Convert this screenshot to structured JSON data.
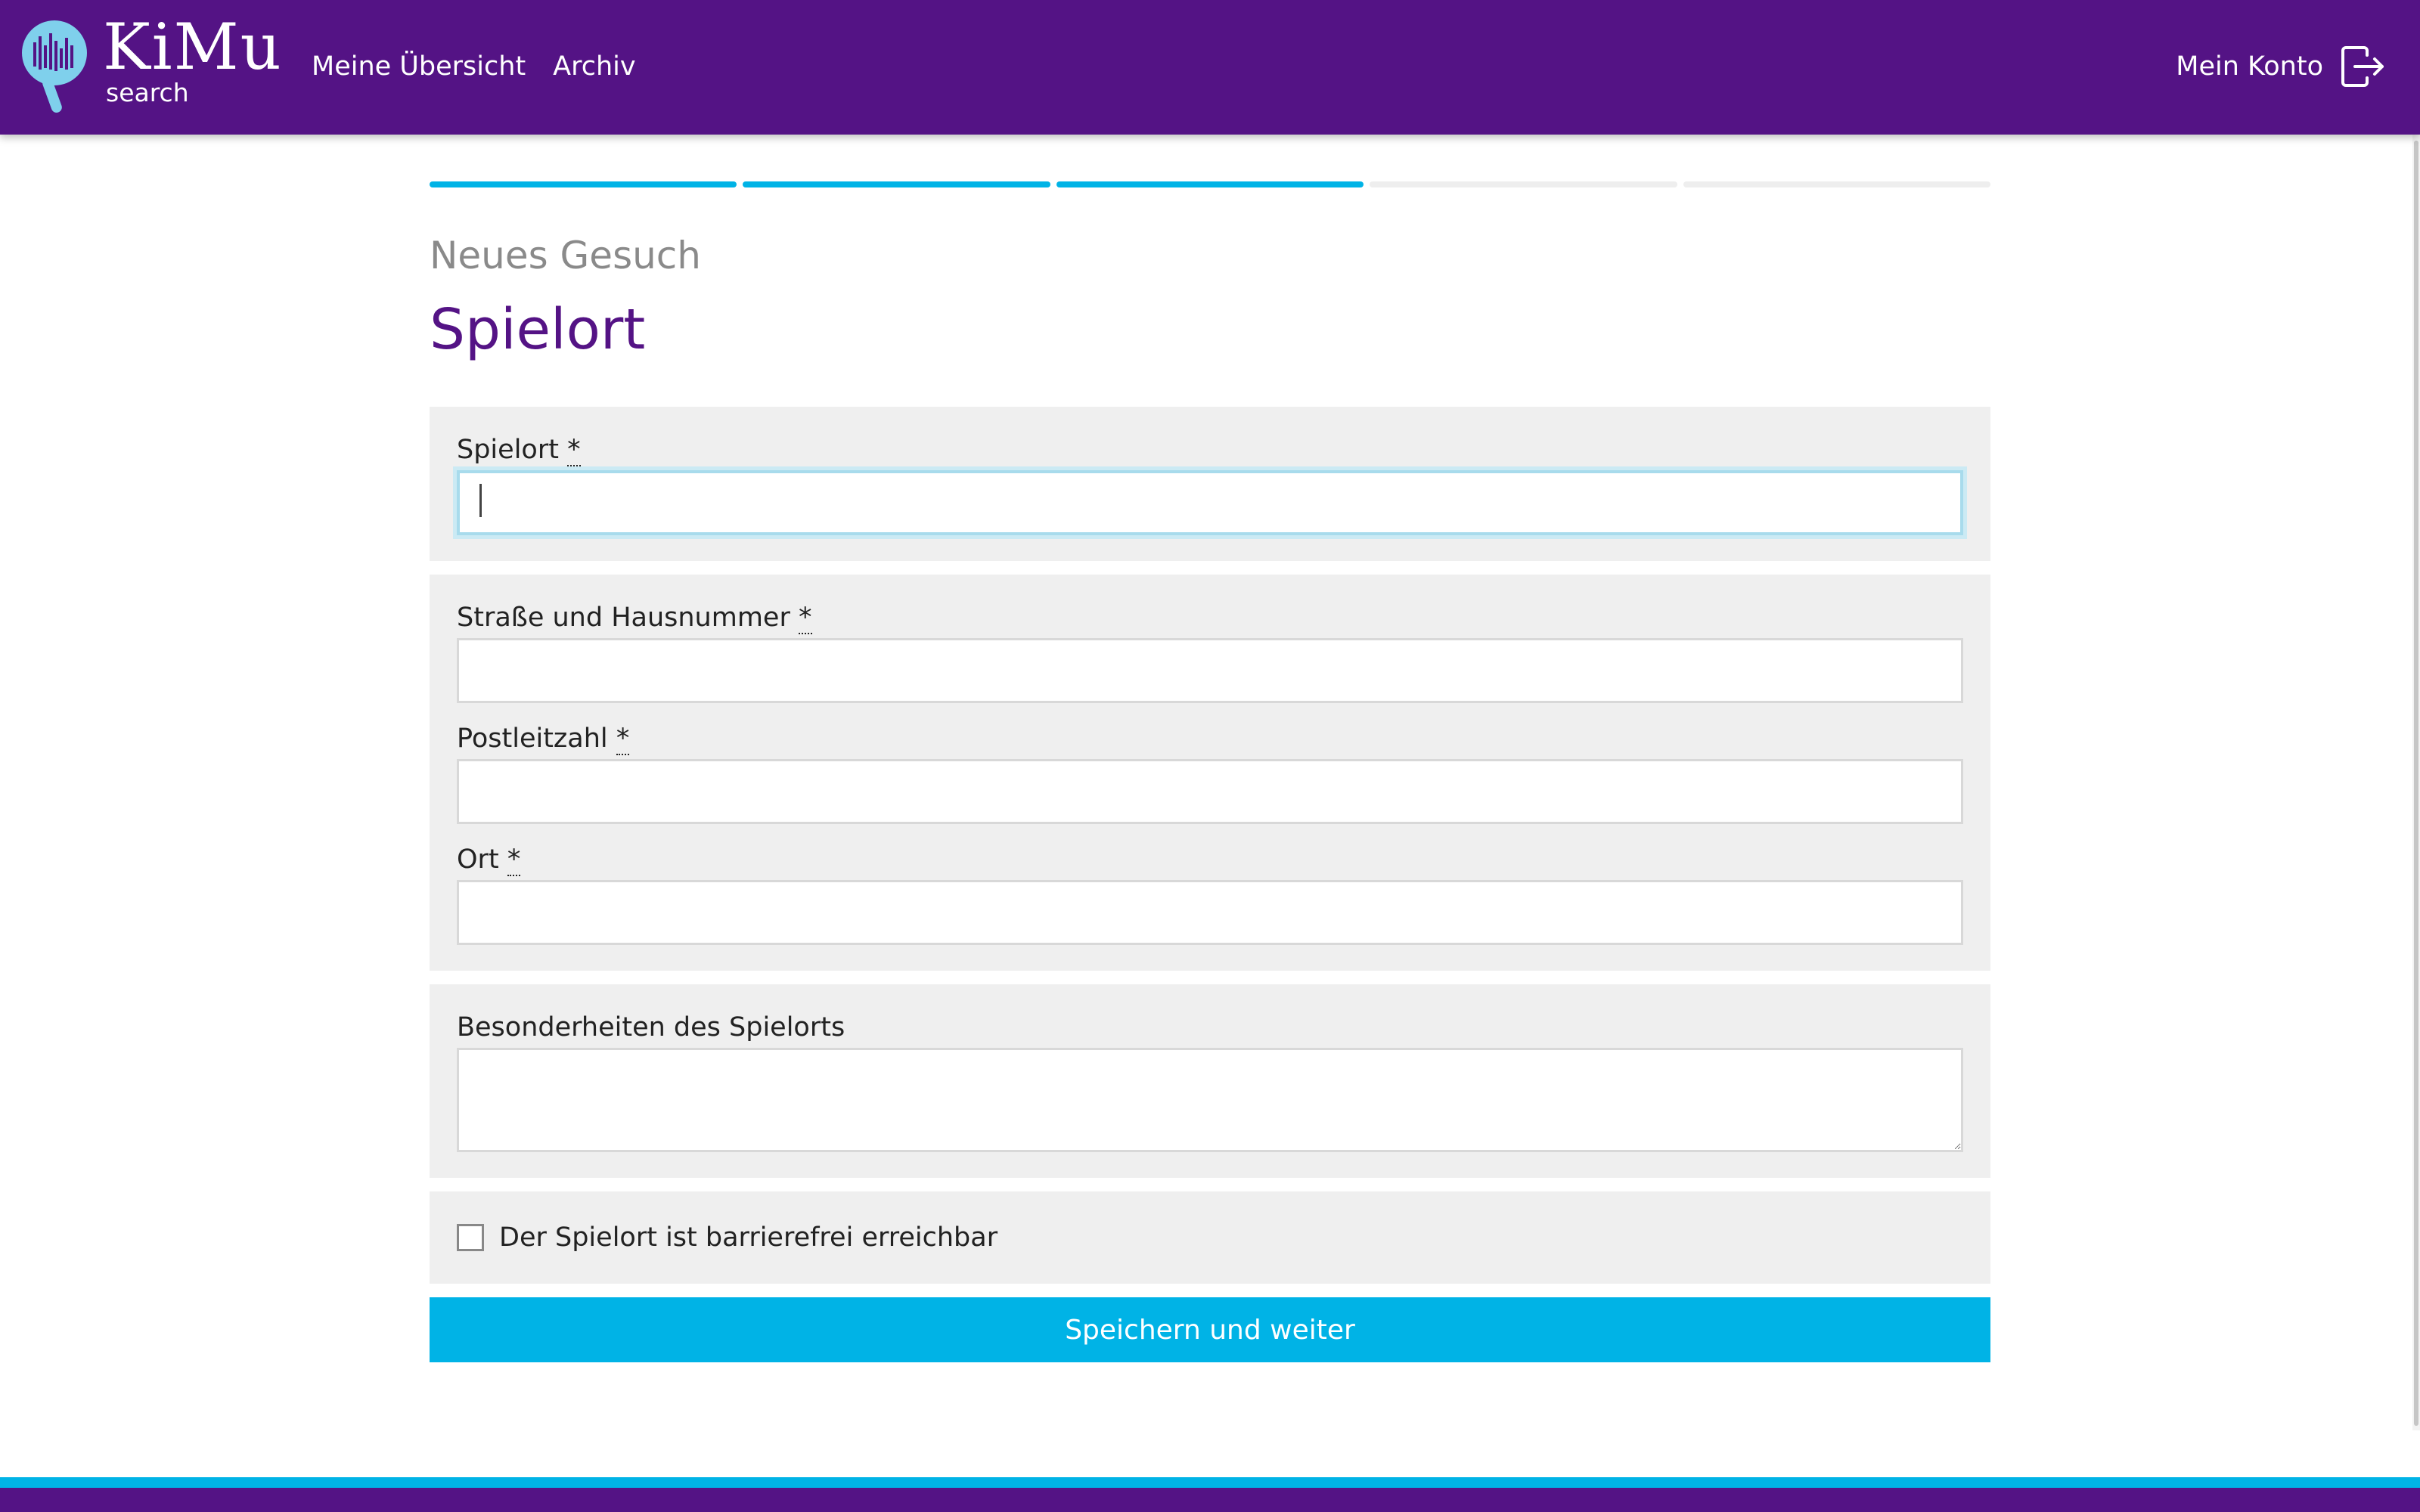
{
  "header": {
    "logo": {
      "name": "KiMu",
      "sub": "search",
      "icon": "magnifier-soundwave-icon"
    },
    "nav": [
      {
        "label": "Meine Übersicht"
      },
      {
        "label": "Archiv"
      }
    ],
    "account": {
      "label": "Mein Konto",
      "icon": "logout-icon"
    }
  },
  "progress": {
    "steps_total": 5,
    "steps_completed": 3
  },
  "main": {
    "kicker": "Neues Gesuch",
    "title": "Spielort"
  },
  "form": {
    "required_mark": "*",
    "spielort": {
      "label": "Spielort",
      "value": ""
    },
    "strasse": {
      "label": "Straße und Hausnummer",
      "value": ""
    },
    "plz": {
      "label": "Postleitzahl",
      "value": ""
    },
    "ort": {
      "label": "Ort",
      "value": ""
    },
    "besonderheiten": {
      "label": "Besonderheiten des Spielorts",
      "value": ""
    },
    "barrierefrei": {
      "label": "Der Spielort ist barrierefrei erreichbar",
      "checked": false
    },
    "submit_label": "Speichern und weiter"
  },
  "colors": {
    "brand_purple": "#541385",
    "accent_cyan": "#00b3e6",
    "panel_grey": "#efefef"
  }
}
